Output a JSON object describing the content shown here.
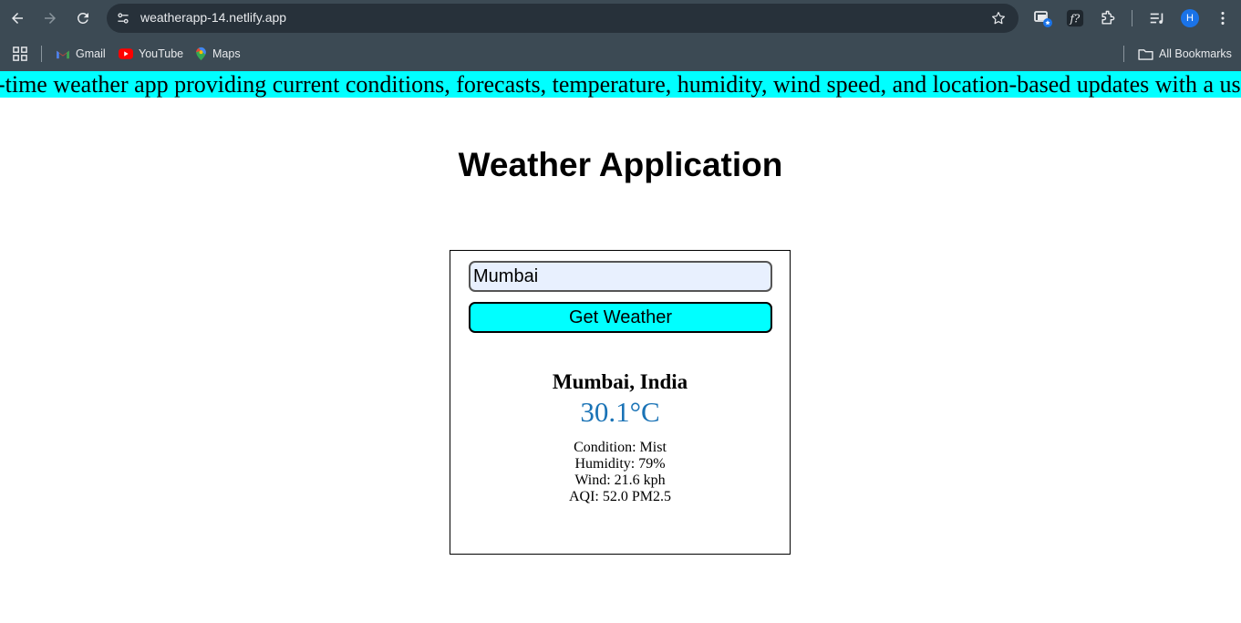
{
  "browser": {
    "url": "weatherapp-14.netlify.app",
    "profile_initial": "H",
    "bookmarks": [
      {
        "label": "Gmail",
        "icon": "gmail-icon"
      },
      {
        "label": "YouTube",
        "icon": "youtube-icon"
      },
      {
        "label": "Maps",
        "icon": "maps-icon"
      }
    ],
    "all_bookmarks_label": "All Bookmarks"
  },
  "page": {
    "marquee_text": "real-time weather app providing current conditions, forecasts, temperature, humidity, wind speed, and location-based updates with a user-friendly interface.",
    "title": "Weather Application",
    "search": {
      "value": "Mumbai",
      "button_label": "Get Weather"
    },
    "result": {
      "location": "Mumbai, India",
      "temperature": "30.1°C",
      "condition": "Condition: Mist",
      "humidity": "Humidity: 79%",
      "wind": "Wind: 21.6 kph",
      "aqi": "AQI: 52.0 PM2.5"
    }
  },
  "colors": {
    "accent": "#00ffff",
    "temperature": "#1a73b6",
    "chrome": "#3c4a54"
  }
}
